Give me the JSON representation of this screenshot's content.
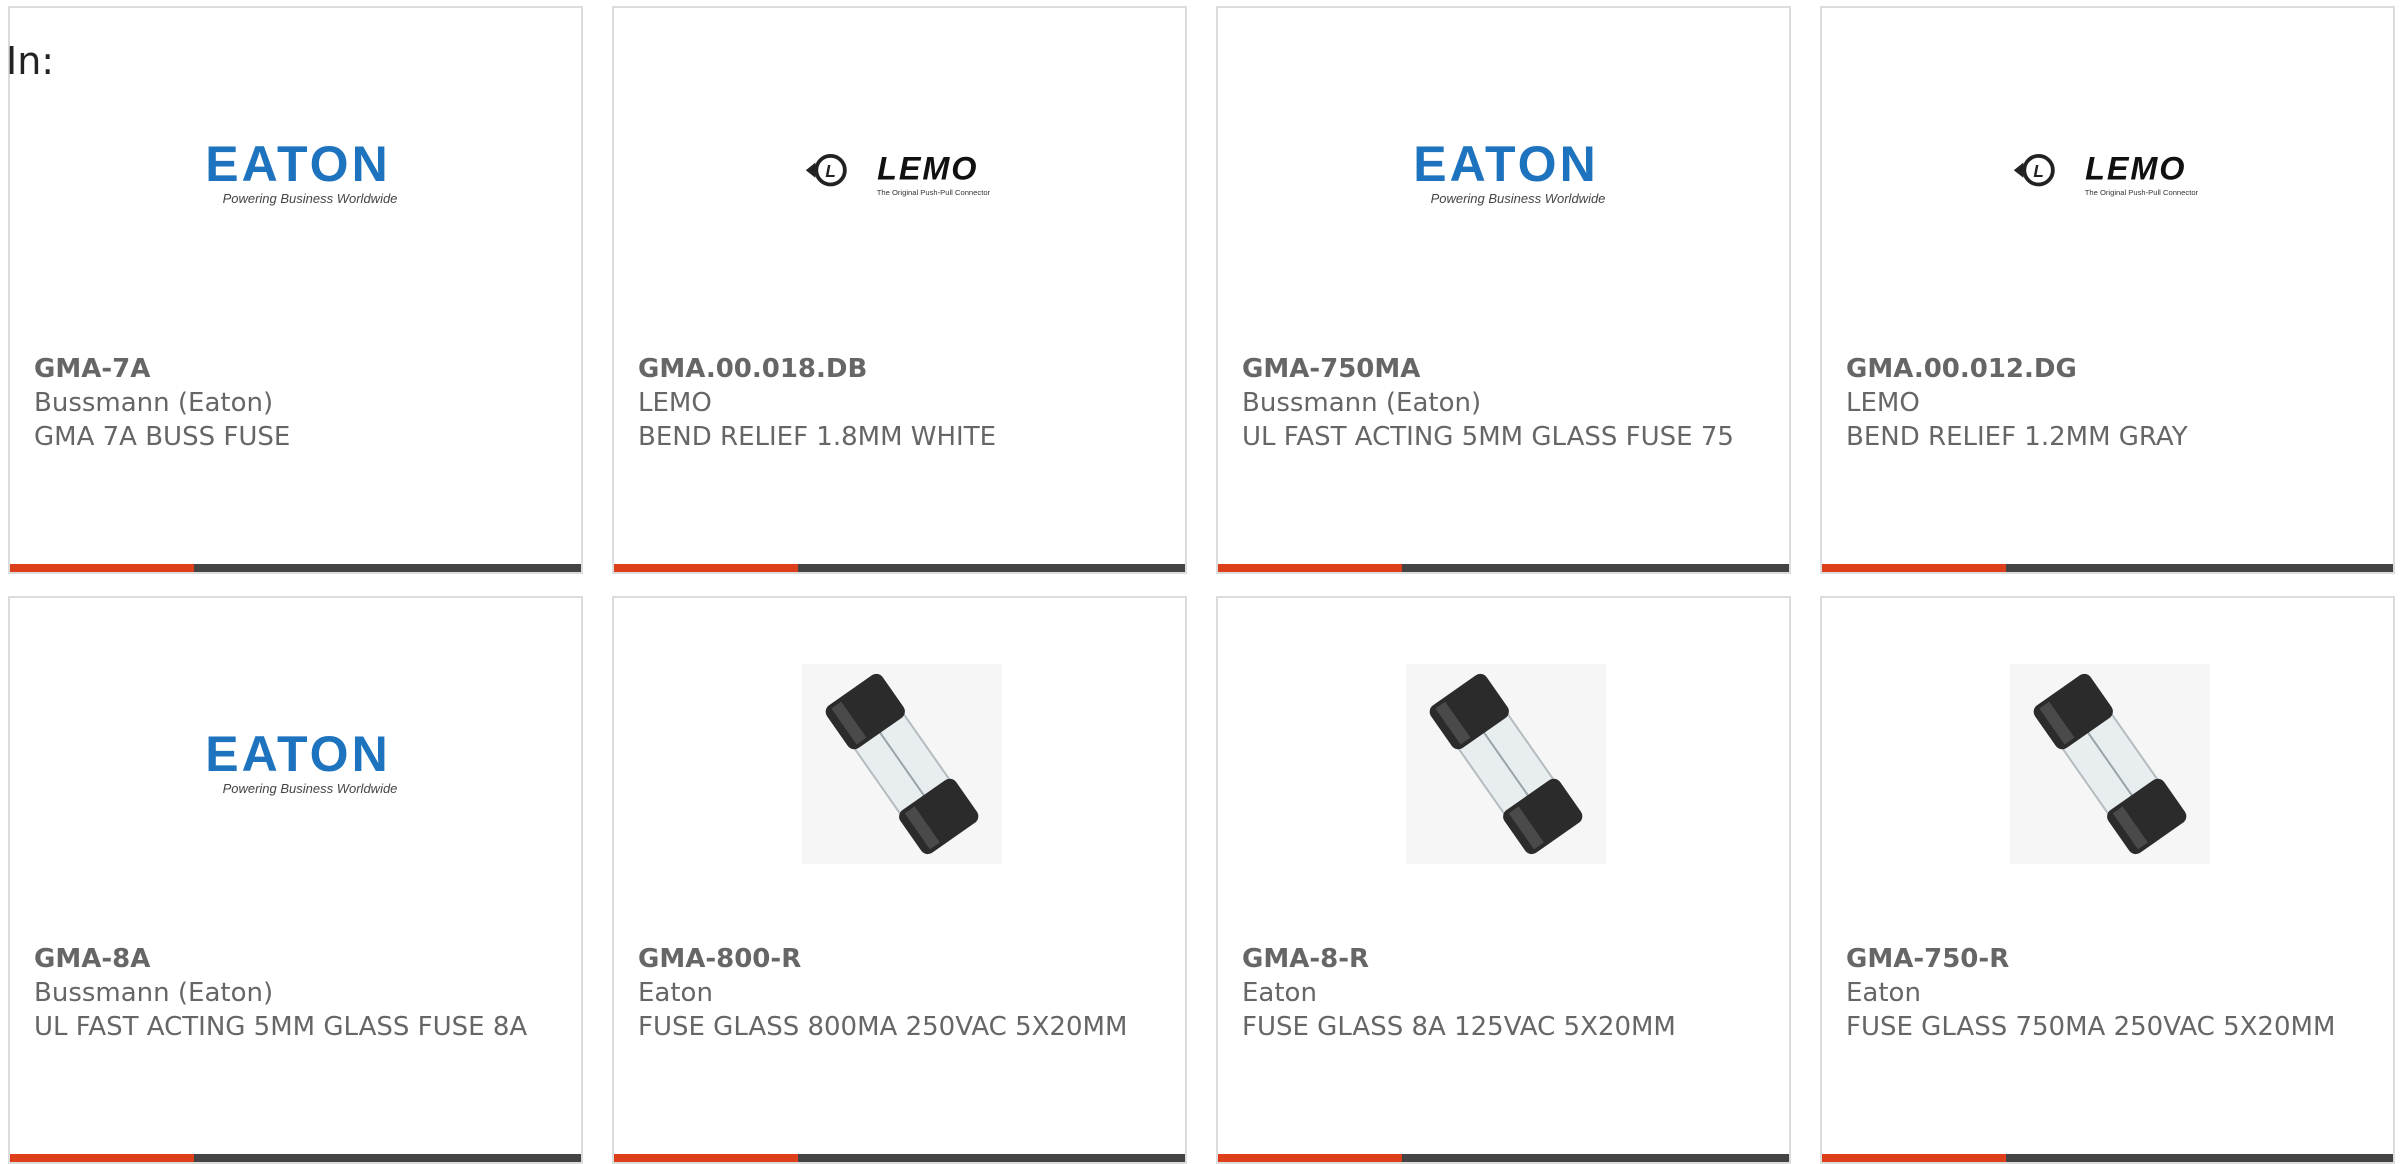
{
  "header": {
    "label": "In:"
  },
  "colors": {
    "accent": "#dd3f1a",
    "bar_dark": "#444444",
    "card_border": "#dcdcdc",
    "text": "#666666",
    "eaton_blue": "#1e73be"
  },
  "logos": {
    "eaton": {
      "wordmark": "EATON",
      "tagline": "Powering Business Worldwide"
    },
    "lemo": {
      "wordmark": "LEMO",
      "tagline": "The Original Push-Pull Connector"
    }
  },
  "products": [
    {
      "part": "GMA-7A",
      "manufacturer": "Bussmann (Eaton)",
      "description": "GMA 7A BUSS FUSE",
      "image": "eaton-logo"
    },
    {
      "part": "GMA.00.018.DB",
      "manufacturer": "LEMO",
      "description": "BEND RELIEF 1.8MM WHITE",
      "image": "lemo-logo"
    },
    {
      "part": "GMA-750MA",
      "manufacturer": "Bussmann (Eaton)",
      "description": "UL FAST ACTING 5MM GLASS FUSE 75",
      "image": "eaton-logo"
    },
    {
      "part": "GMA.00.012.DG",
      "manufacturer": "LEMO",
      "description": "BEND RELIEF 1.2MM GRAY",
      "image": "lemo-logo"
    },
    {
      "part": "GMA-8A",
      "manufacturer": "Bussmann (Eaton)",
      "description": "UL FAST ACTING 5MM GLASS FUSE 8A",
      "image": "eaton-logo"
    },
    {
      "part": "GMA-800-R",
      "manufacturer": "Eaton",
      "description": "FUSE GLASS 800MA 250VAC 5X20MM",
      "image": "glass-fuse-photo"
    },
    {
      "part": "GMA-8-R",
      "manufacturer": "Eaton",
      "description": "FUSE GLASS 8A 125VAC 5X20MM",
      "image": "glass-fuse-photo"
    },
    {
      "part": "GMA-750-R",
      "manufacturer": "Eaton",
      "description": "FUSE GLASS 750MA 250VAC 5X20MM",
      "image": "glass-fuse-photo"
    }
  ]
}
